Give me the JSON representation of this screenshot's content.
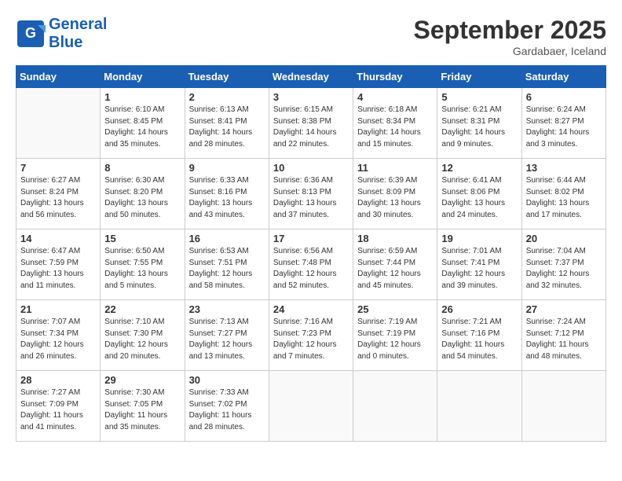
{
  "header": {
    "logo_general": "General",
    "logo_blue": "Blue",
    "month_title": "September 2025",
    "location": "Gardabaer, Iceland"
  },
  "weekdays": [
    "Sunday",
    "Monday",
    "Tuesday",
    "Wednesday",
    "Thursday",
    "Friday",
    "Saturday"
  ],
  "weeks": [
    [
      {
        "day": "",
        "info": ""
      },
      {
        "day": "1",
        "info": "Sunrise: 6:10 AM\nSunset: 8:45 PM\nDaylight: 14 hours\nand 35 minutes."
      },
      {
        "day": "2",
        "info": "Sunrise: 6:13 AM\nSunset: 8:41 PM\nDaylight: 14 hours\nand 28 minutes."
      },
      {
        "day": "3",
        "info": "Sunrise: 6:15 AM\nSunset: 8:38 PM\nDaylight: 14 hours\nand 22 minutes."
      },
      {
        "day": "4",
        "info": "Sunrise: 6:18 AM\nSunset: 8:34 PM\nDaylight: 14 hours\nand 15 minutes."
      },
      {
        "day": "5",
        "info": "Sunrise: 6:21 AM\nSunset: 8:31 PM\nDaylight: 14 hours\nand 9 minutes."
      },
      {
        "day": "6",
        "info": "Sunrise: 6:24 AM\nSunset: 8:27 PM\nDaylight: 14 hours\nand 3 minutes."
      }
    ],
    [
      {
        "day": "7",
        "info": "Sunrise: 6:27 AM\nSunset: 8:24 PM\nDaylight: 13 hours\nand 56 minutes."
      },
      {
        "day": "8",
        "info": "Sunrise: 6:30 AM\nSunset: 8:20 PM\nDaylight: 13 hours\nand 50 minutes."
      },
      {
        "day": "9",
        "info": "Sunrise: 6:33 AM\nSunset: 8:16 PM\nDaylight: 13 hours\nand 43 minutes."
      },
      {
        "day": "10",
        "info": "Sunrise: 6:36 AM\nSunset: 8:13 PM\nDaylight: 13 hours\nand 37 minutes."
      },
      {
        "day": "11",
        "info": "Sunrise: 6:39 AM\nSunset: 8:09 PM\nDaylight: 13 hours\nand 30 minutes."
      },
      {
        "day": "12",
        "info": "Sunrise: 6:41 AM\nSunset: 8:06 PM\nDaylight: 13 hours\nand 24 minutes."
      },
      {
        "day": "13",
        "info": "Sunrise: 6:44 AM\nSunset: 8:02 PM\nDaylight: 13 hours\nand 17 minutes."
      }
    ],
    [
      {
        "day": "14",
        "info": "Sunrise: 6:47 AM\nSunset: 7:59 PM\nDaylight: 13 hours\nand 11 minutes."
      },
      {
        "day": "15",
        "info": "Sunrise: 6:50 AM\nSunset: 7:55 PM\nDaylight: 13 hours\nand 5 minutes."
      },
      {
        "day": "16",
        "info": "Sunrise: 6:53 AM\nSunset: 7:51 PM\nDaylight: 12 hours\nand 58 minutes."
      },
      {
        "day": "17",
        "info": "Sunrise: 6:56 AM\nSunset: 7:48 PM\nDaylight: 12 hours\nand 52 minutes."
      },
      {
        "day": "18",
        "info": "Sunrise: 6:59 AM\nSunset: 7:44 PM\nDaylight: 12 hours\nand 45 minutes."
      },
      {
        "day": "19",
        "info": "Sunrise: 7:01 AM\nSunset: 7:41 PM\nDaylight: 12 hours\nand 39 minutes."
      },
      {
        "day": "20",
        "info": "Sunrise: 7:04 AM\nSunset: 7:37 PM\nDaylight: 12 hours\nand 32 minutes."
      }
    ],
    [
      {
        "day": "21",
        "info": "Sunrise: 7:07 AM\nSunset: 7:34 PM\nDaylight: 12 hours\nand 26 minutes."
      },
      {
        "day": "22",
        "info": "Sunrise: 7:10 AM\nSunset: 7:30 PM\nDaylight: 12 hours\nand 20 minutes."
      },
      {
        "day": "23",
        "info": "Sunrise: 7:13 AM\nSunset: 7:27 PM\nDaylight: 12 hours\nand 13 minutes."
      },
      {
        "day": "24",
        "info": "Sunrise: 7:16 AM\nSunset: 7:23 PM\nDaylight: 12 hours\nand 7 minutes."
      },
      {
        "day": "25",
        "info": "Sunrise: 7:19 AM\nSunset: 7:19 PM\nDaylight: 12 hours\nand 0 minutes."
      },
      {
        "day": "26",
        "info": "Sunrise: 7:21 AM\nSunset: 7:16 PM\nDaylight: 11 hours\nand 54 minutes."
      },
      {
        "day": "27",
        "info": "Sunrise: 7:24 AM\nSunset: 7:12 PM\nDaylight: 11 hours\nand 48 minutes."
      }
    ],
    [
      {
        "day": "28",
        "info": "Sunrise: 7:27 AM\nSunset: 7:09 PM\nDaylight: 11 hours\nand 41 minutes."
      },
      {
        "day": "29",
        "info": "Sunrise: 7:30 AM\nSunset: 7:05 PM\nDaylight: 11 hours\nand 35 minutes."
      },
      {
        "day": "30",
        "info": "Sunrise: 7:33 AM\nSunset: 7:02 PM\nDaylight: 11 hours\nand 28 minutes."
      },
      {
        "day": "",
        "info": ""
      },
      {
        "day": "",
        "info": ""
      },
      {
        "day": "",
        "info": ""
      },
      {
        "day": "",
        "info": ""
      }
    ]
  ]
}
